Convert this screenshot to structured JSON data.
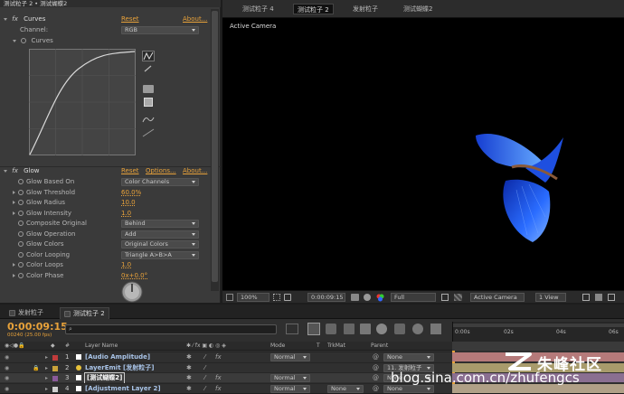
{
  "effect_panel": {
    "tabbar_text": "测试粒子 2 • 测试蝴蝶2",
    "curves": {
      "name": "Curves",
      "reset": "Reset",
      "about": "About...",
      "channel_label": "Channel:",
      "channel_value": "RGB",
      "curves_label": "Curves"
    },
    "glow": {
      "name": "Glow",
      "reset": "Reset",
      "options": "Options...",
      "about": "About...",
      "properties": [
        {
          "label": "Glow Based On",
          "value": "Color Channels",
          "kind": "dropdown"
        },
        {
          "label": "Glow Threshold",
          "value": "60.0%",
          "kind": "number"
        },
        {
          "label": "Glow Radius",
          "value": "10.0",
          "kind": "number"
        },
        {
          "label": "Glow Intensity",
          "value": "1.0",
          "kind": "number"
        },
        {
          "label": "Composite Original",
          "value": "Behind",
          "kind": "dropdown"
        },
        {
          "label": "Glow Operation",
          "value": "Add",
          "kind": "dropdown"
        },
        {
          "label": "Glow Colors",
          "value": "Original Colors",
          "kind": "dropdown"
        },
        {
          "label": "Color Looping",
          "value": "Triangle A>B>A",
          "kind": "dropdown"
        },
        {
          "label": "Color Loops",
          "value": "1.0",
          "kind": "number"
        },
        {
          "label": "Color Phase",
          "value": "0x+0.0°",
          "kind": "number"
        }
      ]
    }
  },
  "viewer": {
    "tabs": [
      "测试粒子 4",
      "测试粒子 2",
      "发射粒子",
      "测试蝴蝶2"
    ],
    "active_tab": 1,
    "active_camera": "Active Camera",
    "bar": {
      "zoom": "100%",
      "timecode": "0:00:09:15",
      "resolution": "Full",
      "camera": "Active Camera",
      "view": "1 View"
    }
  },
  "timeline": {
    "tabs": [
      "发射粒子",
      "测试粒子 2"
    ],
    "timecode": "0:00:09:15",
    "frames": "00240 (25.00 fps)",
    "search_placeholder": "",
    "ruler": [
      "0:00s",
      "02s",
      "04s",
      "06s"
    ],
    "columns": {
      "layer_name": "Layer Name",
      "mode": "Mode",
      "t": "T",
      "trkmat": "TrkMat",
      "parent": "Parent"
    },
    "layers": [
      {
        "num": "1",
        "name": "[Audio Amplitude]",
        "swatch": "#c13b3b",
        "mode": "Normal",
        "trkmat": "",
        "parent": "None",
        "track": "#b57a7a"
      },
      {
        "num": "2",
        "name": "LayerEmit [发射粒子]",
        "swatch": "#c9a23a",
        "mode": "",
        "trkmat": "",
        "parent": "11. 发射粒子",
        "track": "#a89b6b"
      },
      {
        "num": "3",
        "name": "[测试蝴蝶2]",
        "swatch": "#8a5a9a",
        "mode": "Normal",
        "trkmat": "",
        "parent": "None",
        "track": "#8a6f91"
      },
      {
        "num": "4",
        "name": "[Adjustment Layer 2]",
        "swatch": "#cfcfcf",
        "mode": "Normal",
        "trkmat": "None",
        "parent": "None",
        "track": "#b0a087"
      }
    ]
  },
  "watermark": {
    "brand": "朱峰社区",
    "url": "blog.sina.com.cn/zhufengcs"
  },
  "colors": {
    "accent": "#e8a23a",
    "butterfly_blue": "#2a6cff"
  }
}
